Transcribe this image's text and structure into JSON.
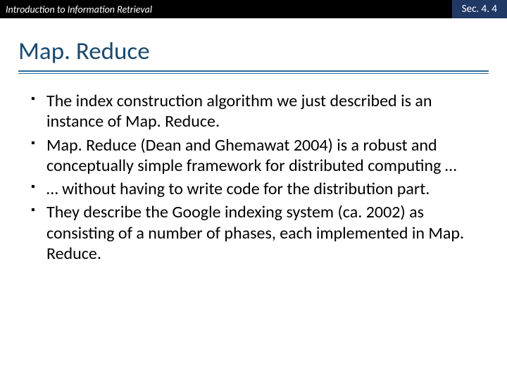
{
  "header": {
    "left": "Introduction to Information Retrieval",
    "right": "Sec. 4. 4"
  },
  "title": "Map. Reduce",
  "bullets": [
    "The index construction algorithm we just described is an instance of Map. Reduce.",
    "Map. Reduce (Dean and Ghemawat 2004) is a robust and conceptually simple framework for distributed computing …",
    "… without having to write code for the distribution part.",
    "They describe the Google indexing system (ca. 2002) as consisting of a number of phases, each implemented in Map. Reduce."
  ]
}
